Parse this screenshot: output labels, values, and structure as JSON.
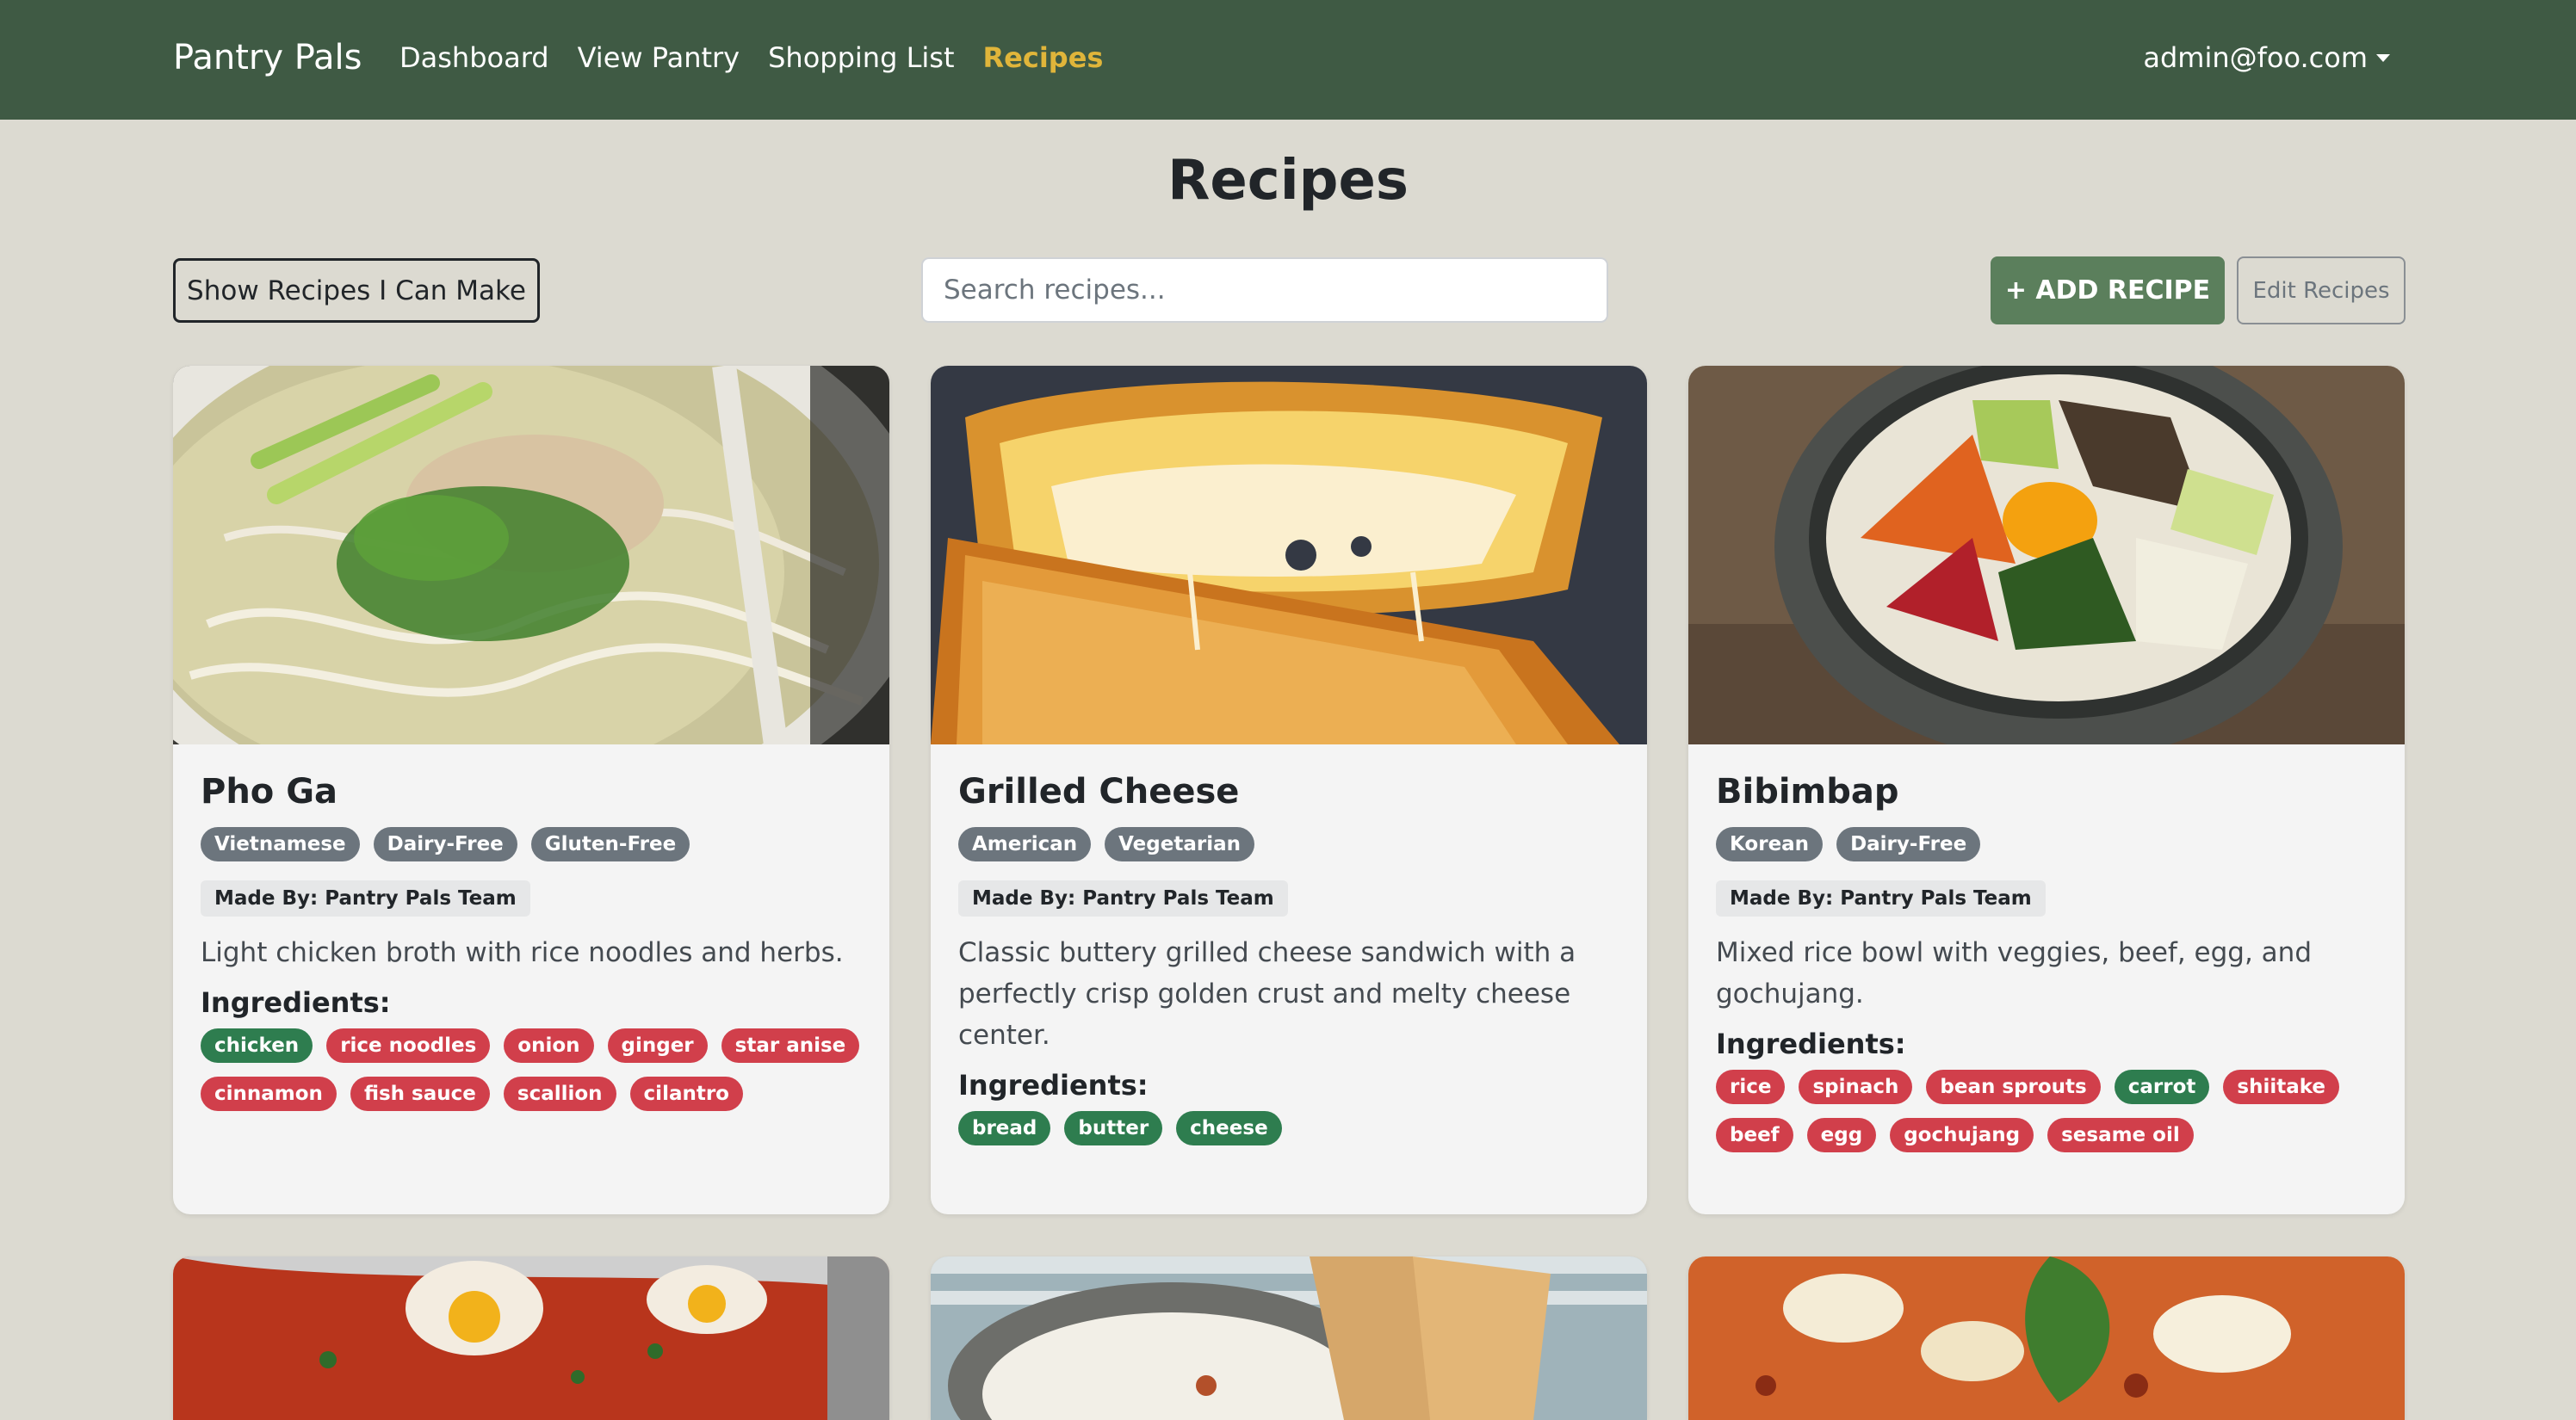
{
  "nav": {
    "brand": "Pantry Pals",
    "links": [
      {
        "label": "Dashboard",
        "active": false
      },
      {
        "label": "View Pantry",
        "active": false
      },
      {
        "label": "Shopping List",
        "active": false
      },
      {
        "label": "Recipes",
        "active": true
      }
    ],
    "user": "admin@foo.com"
  },
  "page": {
    "title": "Recipes"
  },
  "toolbar": {
    "show_label": "Show Recipes I Can Make",
    "search_placeholder": "Search recipes...",
    "search_value": "",
    "add_label": "+ ADD RECIPE",
    "edit_label": "Edit Recipes"
  },
  "colors": {
    "navbar": "#3f5a44",
    "active_link": "#e0b53a",
    "background": "#dcdad1",
    "add_button": "#5b7f5c",
    "ingredient_have": "#2e7d4f",
    "ingredient_missing": "#d13f4b",
    "tag": "#6c757d"
  },
  "recipes": [
    {
      "title": "Pho Ga",
      "image": "chicken pho bowl",
      "tags": [
        "Vietnamese",
        "Dairy-Free",
        "Gluten-Free"
      ],
      "made_by": "Made By: Pantry Pals Team",
      "description": "Light chicken broth with rice noodles and herbs.",
      "ingredients_label": "Ingredients:",
      "ingredients": [
        {
          "name": "chicken",
          "have": true
        },
        {
          "name": "rice noodles",
          "have": false
        },
        {
          "name": "onion",
          "have": false
        },
        {
          "name": "ginger",
          "have": false
        },
        {
          "name": "star anise",
          "have": false
        },
        {
          "name": "cinnamon",
          "have": false
        },
        {
          "name": "fish sauce",
          "have": false
        },
        {
          "name": "scallion",
          "have": false
        },
        {
          "name": "cilantro",
          "have": false
        }
      ]
    },
    {
      "title": "Grilled Cheese",
      "image": "grilled cheese sandwich",
      "tags": [
        "American",
        "Vegetarian"
      ],
      "made_by": "Made By: Pantry Pals Team",
      "description": "Classic buttery grilled cheese sandwich with a perfectly crisp golden crust and melty cheese center.",
      "ingredients_label": "Ingredients:",
      "ingredients": [
        {
          "name": "bread",
          "have": true
        },
        {
          "name": "butter",
          "have": true
        },
        {
          "name": "cheese",
          "have": true
        }
      ]
    },
    {
      "title": "Bibimbap",
      "image": "bibimbap stone bowl",
      "tags": [
        "Korean",
        "Dairy-Free"
      ],
      "made_by": "Made By: Pantry Pals Team",
      "description": "Mixed rice bowl with veggies, beef, egg, and gochujang.",
      "ingredients_label": "Ingredients:",
      "ingredients": [
        {
          "name": "rice",
          "have": false
        },
        {
          "name": "spinach",
          "have": false
        },
        {
          "name": "bean sprouts",
          "have": false
        },
        {
          "name": "carrot",
          "have": true
        },
        {
          "name": "shiitake",
          "have": false
        },
        {
          "name": "beef",
          "have": false
        },
        {
          "name": "egg",
          "have": false
        },
        {
          "name": "gochujang",
          "have": false
        },
        {
          "name": "sesame oil",
          "have": false
        }
      ]
    },
    {
      "image": "shakshuka pan"
    },
    {
      "image": "rice with naan bread"
    },
    {
      "image": "pizza with basil"
    }
  ]
}
